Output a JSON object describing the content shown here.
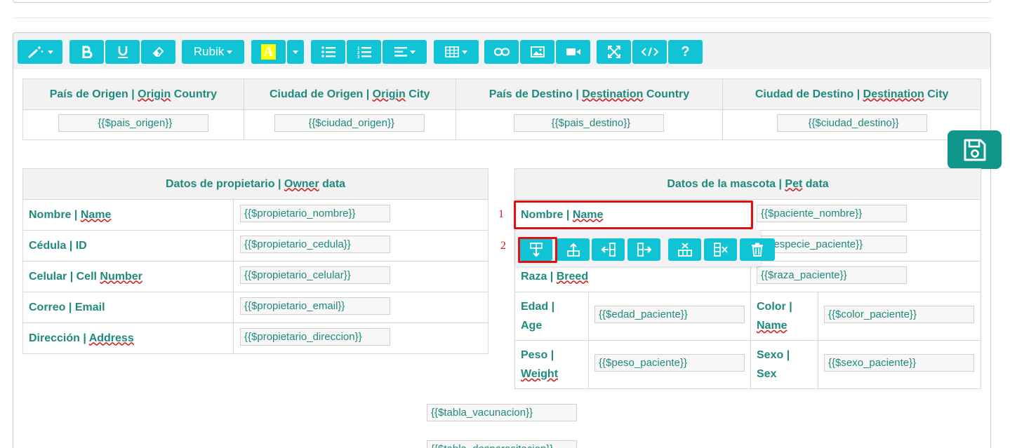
{
  "toolbar": {
    "font_label": "Rubik",
    "color_letter": "A",
    "help_label": "?"
  },
  "route_table": {
    "headers": [
      {
        "es": "País de Origen",
        "en1": "Origin",
        "en2": "Country"
      },
      {
        "es": "Ciudad de Origen",
        "en1": "Origin",
        "en2": "City"
      },
      {
        "es": "País de Destino",
        "en1": "Destination",
        "en2": "Country"
      },
      {
        "es": "Ciudad de Destino",
        "en1": "Destination",
        "en2": "City"
      }
    ],
    "values": [
      "{{$pais_origen}}",
      "{{$ciudad_origen}}",
      "{{$pais_destino}}",
      "{{$ciudad_destino}}"
    ]
  },
  "owner_table": {
    "header_es": "Datos de propietario",
    "header_en1": "Owner",
    "header_en2": "data",
    "rows": [
      {
        "es": "Nombre",
        "en": "Name",
        "value": "{{$propietario_nombre}}"
      },
      {
        "es": "Cédula",
        "en": "ID",
        "value": "{{$propietario_cedula}}"
      },
      {
        "es": "Celular",
        "en_plain": "Cell",
        "en": "Number",
        "value": "{{$propietario_celular}}"
      },
      {
        "es": "Correo",
        "en": "Email",
        "value": "{{$propietario_email}}"
      },
      {
        "es": "Dirección",
        "en": "Address",
        "value": "{{$propietario_direccion}}"
      }
    ]
  },
  "pet_table": {
    "header_es": "Datos de la mascota",
    "header_en1": "Pet",
    "header_en2": "data",
    "name_es": "Nombre",
    "name_en": "Name",
    "name_value": "{{$paciente_nombre}}",
    "species_value": "{{$especie_paciente}}",
    "species_visible": "especie_paciente}}",
    "breed_es": "Raza",
    "breed_en": "Breed",
    "breed_value": "{{$raza_paciente}}",
    "age_es": "Edad |",
    "age_en": "Age",
    "age_value": "{{$edad_paciente}}",
    "color_es": "Color |",
    "color_en": "Name",
    "color_value": "{{$color_paciente}}",
    "weight_es": "Peso |",
    "weight_en": "Weight",
    "weight_value": "{{$peso_paciente}}",
    "sex_es": "Sexo |",
    "sex_en": "Sex",
    "sex_value": "{{$sexo_paciente}}"
  },
  "loose_fields": {
    "vaccination": "{{$tabla_vacunacion}}",
    "deworming": "{{$tabla_desparasitacion}}"
  },
  "annotations": {
    "one": "1",
    "two": "2"
  },
  "colors": {
    "toolbar_button": "#10c4d6",
    "save_button": "#10968a",
    "text": "#1e8a7d",
    "annotation": "#e01010"
  }
}
